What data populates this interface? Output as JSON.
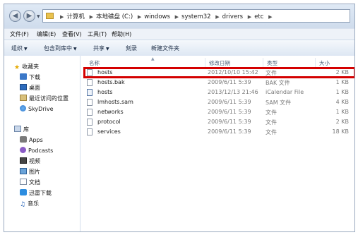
{
  "address": {
    "crumbs": [
      "计算机",
      "本地磁盘 (C:)",
      "windows",
      "system32",
      "drivers",
      "etc"
    ]
  },
  "menubar": [
    "文件(F)",
    "编辑(E)",
    "查看(V)",
    "工具(T)",
    "帮助(H)"
  ],
  "toolbar": {
    "organize": "组织",
    "include": "包含到库中",
    "share": "共享",
    "burn": "刻录",
    "new_folder": "新建文件夹"
  },
  "nav": {
    "favorites": "收藏夹",
    "downloads": "下载",
    "desktop": "桌面",
    "recent": "最近访问的位置",
    "skydrive": "SkyDrive",
    "libraries": "库",
    "apps": "Apps",
    "podcasts": "Podcasts",
    "videos": "视频",
    "pictures": "图片",
    "documents": "文档",
    "xunlei": "迅雷下载",
    "music": "音乐"
  },
  "columns": {
    "name": "名称",
    "modified": "修改日期",
    "type": "类型",
    "size": "大小"
  },
  "files": [
    {
      "name": "hosts",
      "date": "2012/10/10 15:42",
      "type": "文件",
      "size": "2 KB"
    },
    {
      "name": "hosts.bak",
      "date": "2009/6/11 5:39",
      "type": "BAK 文件",
      "size": "1 KB"
    },
    {
      "name": "hosts",
      "date": "2013/12/13 21:46",
      "type": "iCalendar File",
      "size": "1 KB"
    },
    {
      "name": "lmhosts.sam",
      "date": "2009/6/11 5:39",
      "type": "SAM 文件",
      "size": "4 KB"
    },
    {
      "name": "networks",
      "date": "2009/6/11 5:39",
      "type": "文件",
      "size": "1 KB"
    },
    {
      "name": "protocol",
      "date": "2009/6/11 5:39",
      "type": "文件",
      "size": "2 KB"
    },
    {
      "name": "services",
      "date": "2009/6/11 5:39",
      "type": "文件",
      "size": "18 KB"
    }
  ],
  "colors": {
    "highlight": "#d40000",
    "accent": "#1e5fb4"
  }
}
